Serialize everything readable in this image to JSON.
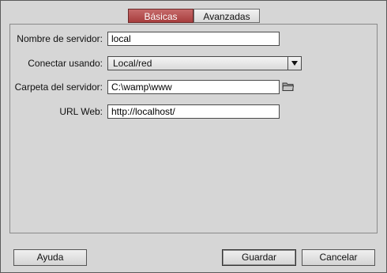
{
  "tabs": [
    {
      "label": "Básicas",
      "active": true
    },
    {
      "label": "Avanzadas",
      "active": false
    }
  ],
  "form": {
    "server_name": {
      "label": "Nombre de servidor:",
      "value": "local"
    },
    "connect_using": {
      "label": "Conectar usando:",
      "value": "Local/red"
    },
    "server_folder": {
      "label": "Carpeta del servidor:",
      "value": "C:\\wamp\\www"
    },
    "web_url": {
      "label": "URL Web:",
      "value": "http://localhost/"
    }
  },
  "buttons": {
    "help": "Ayuda",
    "save": "Guardar",
    "cancel": "Cancelar"
  },
  "colors": {
    "active_tab": "#b04848",
    "background": "#d6d6d6"
  }
}
